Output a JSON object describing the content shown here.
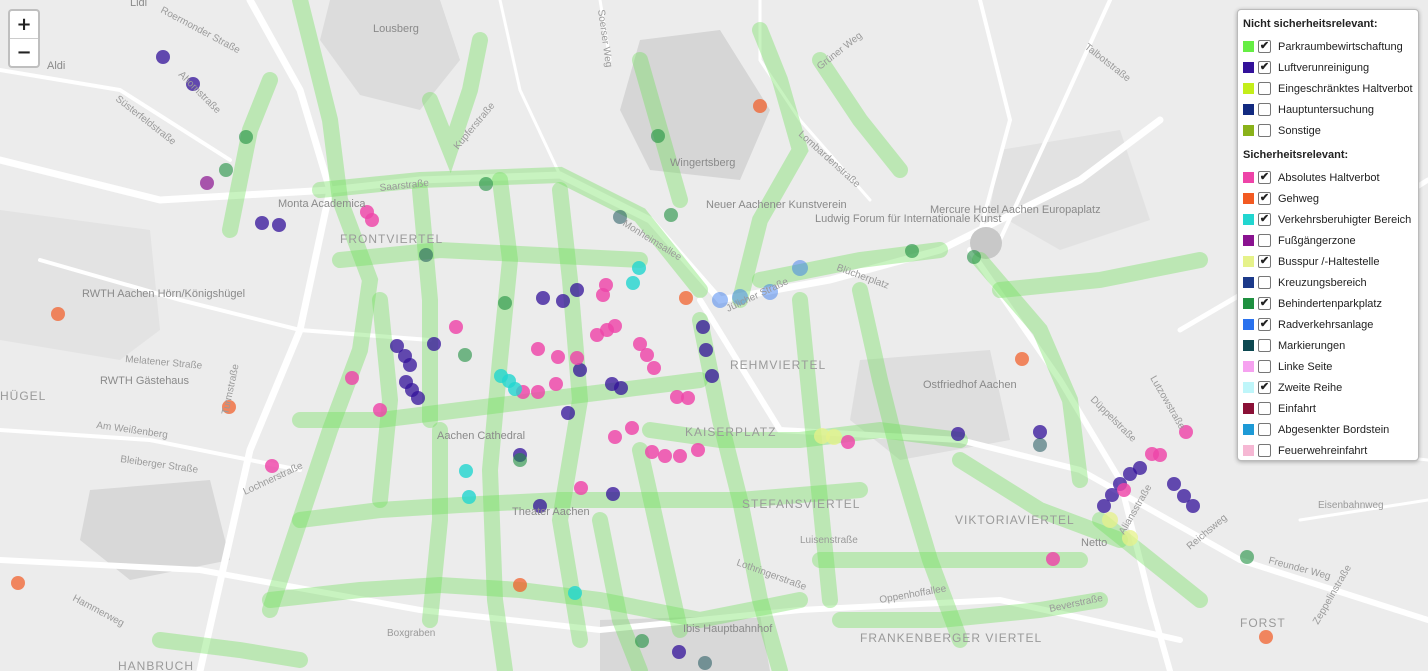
{
  "zoom": {
    "in_label": "+",
    "out_label": "−"
  },
  "map_labels": {
    "places": [
      "Lousberg",
      "Wingertsberg",
      "Neuer Aachener Kunstverein",
      "Ludwig Forum für Internationale Kunst",
      "Mercure Hotel Aachen Europaplatz",
      "RWTH Aachen Hörn/Königshügel",
      "RWTH Gästehaus",
      "Ostfriedhof Aachen",
      "Aachen Cathedral",
      "Theater Aachen",
      "Ibis Hauptbahnhof",
      "Aldi",
      "Netto",
      "Lidl",
      "Monta Academica"
    ],
    "districts": [
      "FRONTVIERTEL",
      "REHMVIERTEL",
      "KAISERPLATZ",
      "STEFANSVIERTEL",
      "VIKTORIAVIERTEL",
      "FRANKENBERGER VIERTEL",
      "HÜGEL",
      "FORST",
      "HANBRUCH"
    ],
    "streets": [
      "Süsterfeldstraße",
      "Turmstraße",
      "Melatener Straße",
      "Am Weißenberg",
      "Bleiberger Straße",
      "Hammerweg",
      "Lochnerstraße",
      "Boxgraben",
      "Jülicher Straße",
      "Lombardenstraße",
      "Blücherplatz",
      "Monheimsallee",
      "Soerser Weg",
      "Grüner Weg",
      "Oppenhoffallee",
      "Luisenstraße",
      "Lothringerstraße",
      "Beverstraße",
      "Eisenbahnweg",
      "Freunder Weg",
      "Zeppelinstraße",
      "Aliansstraße",
      "Reichsweg",
      "Düppelstraße",
      "Lutzowstraße",
      "Talbotstraße",
      "Kupferstraße",
      "Ahornstraße",
      "Roermonder Straße",
      "Saarstraße"
    ]
  },
  "legend": {
    "non_safety_title": "Nicht sicherheitsrelevant:",
    "non_safety": [
      {
        "label": "Parkraumbewirtschaftung",
        "color": "#66ee44",
        "checked": true
      },
      {
        "label": "Luftverunreinigung",
        "color": "#33119a",
        "checked": true
      },
      {
        "label": "Eingeschränktes Haltverbot",
        "color": "#c4ee1a",
        "checked": false
      },
      {
        "label": "Hauptuntersuchung",
        "color": "#122a80",
        "checked": false
      },
      {
        "label": "Sonstige",
        "color": "#8ab21a",
        "checked": false
      }
    ],
    "safety_title": "Sicherheitsrelevant:",
    "safety": [
      {
        "label": "Absolutes Haltverbot",
        "color": "#ee44a8",
        "checked": true
      },
      {
        "label": "Gehweg",
        "color": "#f25a22",
        "checked": true
      },
      {
        "label": "Verkehrsberuhigter Bereich",
        "color": "#22d6d0",
        "checked": true
      },
      {
        "label": "Fußgängerzone",
        "color": "#8a1290",
        "checked": false
      },
      {
        "label": "Busspur /-Haltestelle",
        "color": "#e6f28a",
        "checked": true
      },
      {
        "label": "Kreuzungsbereich",
        "color": "#1c3a8a",
        "checked": false
      },
      {
        "label": "Behindertenparkplatz",
        "color": "#1e9040",
        "checked": true
      },
      {
        "label": "Radverkehrsanlage",
        "color": "#2a72ee",
        "checked": true
      },
      {
        "label": "Markierungen",
        "color": "#0c4850",
        "checked": false
      },
      {
        "label": "Linke Seite",
        "color": "#f6a2f0",
        "checked": false
      },
      {
        "label": "Zweite Reihe",
        "color": "#bff6fa",
        "checked": true
      },
      {
        "label": "Einfahrt",
        "color": "#8a1036",
        "checked": false
      },
      {
        "label": "Abgesenkter Bordstein",
        "color": "#1e9ad6",
        "checked": false
      },
      {
        "label": "Feuerwehreinfahrt",
        "color": "#f6b8d4",
        "checked": false
      }
    ]
  }
}
